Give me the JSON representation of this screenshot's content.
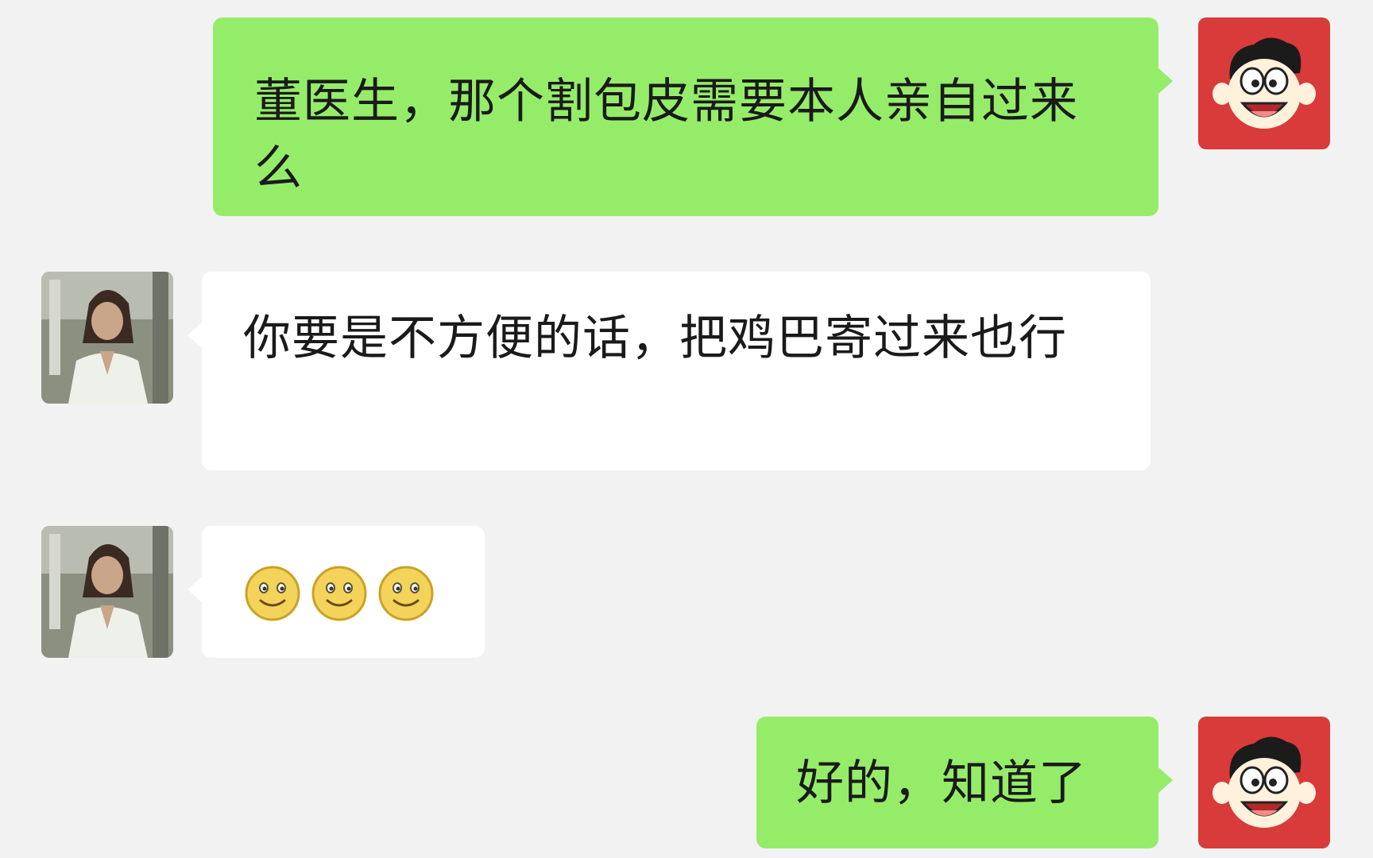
{
  "messages": [
    {
      "sender": "self",
      "avatar": "cartoon-face-avatar",
      "text": "董医生，那个割包皮需要本人亲自过来么"
    },
    {
      "sender": "doctor",
      "avatar": "doctor-photo-avatar",
      "text": "你要是不方便的话，把鸡巴寄过来也行"
    },
    {
      "sender": "doctor",
      "avatar": "doctor-photo-avatar",
      "emojis": [
        "smile-emoji",
        "smile-emoji",
        "smile-emoji"
      ]
    },
    {
      "sender": "self",
      "avatar": "cartoon-face-avatar",
      "text": "好的，知道了"
    }
  ],
  "colors": {
    "background": "#f2f2f2",
    "outgoing_bubble": "#95ec69",
    "incoming_bubble": "#ffffff",
    "self_avatar_bg": "#d93a3a",
    "emoji_yellow": "#f4d35a"
  }
}
